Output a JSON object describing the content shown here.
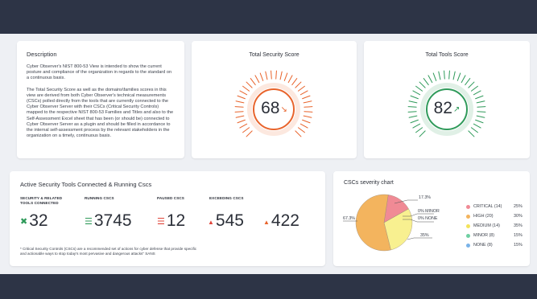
{
  "description": {
    "title": "Description",
    "paragraph1": "Cyber Observer's NIST 800-53 View is intended to show the current posture and compliance of the organization in regards to the standard on a continuous basis.",
    "paragraph2": "The Total Security Score as well as the domains\\families scores in this view are derived from both Cyber Observer's technical measurements (CSCs) polled directly from the tools that are currently connected to the Cyber Observer Server with their CSCs (Critical Security Controls) mapped to the respective NIST 800-53 Families and Titles and also to the Self-Assessment Excel sheet that has been (or should be) connected to Cyber Observer Server as a plugin and should be filled in accordance to the internal self-assessment process by the relevant stakeholders in the organization on a timely, continuous basis."
  },
  "security_score": {
    "title": "Total Security Score",
    "value": "68",
    "trend_icon": "arrow-down-right-icon",
    "trend_glyph": "↘",
    "color": "#e8632b"
  },
  "tools_score": {
    "title": "Total Tools Score",
    "value": "82",
    "trend_icon": "arrow-up-right-icon",
    "trend_glyph": "↗",
    "color": "#2f9a5a"
  },
  "active_tools": {
    "title": "Active Security Tools Connected & Running Cscs",
    "stats": {
      "connected": {
        "label_line1": "SECURITY & RELATED",
        "label_line2": "TOOLS CONNECTED",
        "value": "32",
        "icon": "tools-icon",
        "glyph": "✖",
        "color": "#2f9a5a"
      },
      "running": {
        "label": "RUNNING CSCS",
        "value": "3745",
        "icon": "list-icon",
        "glyph": "☰",
        "color": "#2f9a5a"
      },
      "paused": {
        "label": "PAUSED CSCS",
        "value": "12",
        "icon": "list-icon",
        "glyph": "☰",
        "color": "#e0453a"
      },
      "exceeding": {
        "label": "EXCEEDING CSCS",
        "value1": "545",
        "value2": "422",
        "icon": "warning-icon",
        "glyph1": "▲",
        "glyph2": "▲",
        "color1": "#e0453a",
        "color2": "#e8632b"
      }
    },
    "footnote_line1": "* Critical Security Controls (CSCs) are a recommended set of actions for cyber defense that provide specific",
    "footnote_line2": "and actionable ways to stop today's most pervasive and dangerous attacks\" SANS"
  },
  "severity_chart": {
    "title": "CSCs severity chart",
    "slice_labels": {
      "critical": "17.3%",
      "minor": "0% MINOR",
      "none": "0% NONE",
      "medium": "35%",
      "high": "67.3%"
    },
    "legend": [
      {
        "label": "CRITICAL (14)",
        "pct": "25%",
        "color": "#f08a95"
      },
      {
        "label": "HIGH (20)",
        "pct": "30%",
        "color": "#f3b45e"
      },
      {
        "label": "MEDIUM (14)",
        "pct": "35%",
        "color": "#f3e35a"
      },
      {
        "label": "MINOR (8)",
        "pct": "15%",
        "color": "#6fd0a2"
      },
      {
        "label": "NONE (8)",
        "pct": "15%",
        "color": "#7ab3e8"
      }
    ]
  },
  "chart_data": {
    "type": "pie",
    "title": "CSCs severity chart",
    "slices": [
      {
        "name": "CRITICAL",
        "value": 17.3,
        "color": "#f08a95"
      },
      {
        "name": "HIGH",
        "value": 67.3,
        "color": "#f3b45e"
      },
      {
        "name": "MEDIUM",
        "value": 35,
        "color": "#f8f090"
      },
      {
        "name": "MINOR",
        "value": 0,
        "color": "#6fd0a2"
      },
      {
        "name": "NONE",
        "value": 0,
        "color": "#7ab3e8"
      }
    ],
    "legend_placement": "right"
  }
}
